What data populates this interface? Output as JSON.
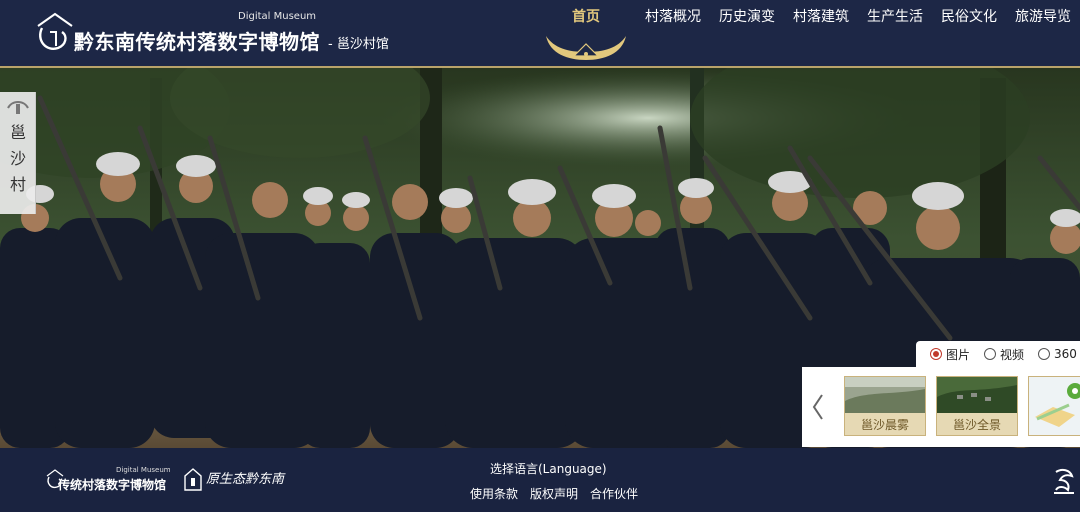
{
  "header": {
    "site_title": "黔东南传统村落数字博物馆",
    "digital_museum": "Digital Museum",
    "village": "- 邕沙村馆",
    "nav": [
      {
        "label": "首页",
        "active": true
      },
      {
        "label": "村落概况"
      },
      {
        "label": "历史演变"
      },
      {
        "label": "村落建筑"
      },
      {
        "label": "生产生活"
      },
      {
        "label": "民俗文化"
      },
      {
        "label": "旅游导览"
      }
    ]
  },
  "side_tab": {
    "label": "邕沙村"
  },
  "media_toggle": {
    "options": [
      {
        "label": "图片",
        "selected": true
      },
      {
        "label": "视频",
        "selected": false
      },
      {
        "label": "360",
        "selected": false
      }
    ]
  },
  "thumbnails": [
    {
      "label": "邕沙晨雾"
    },
    {
      "label": "邕沙全景"
    },
    {
      "label": ""
    }
  ],
  "footer": {
    "logo_title": "传统村落数字博物馆",
    "logo_dm": "Digital Museum",
    "partner_name": "原生态黔东南",
    "language_label": "选择语言(Language)",
    "links": [
      "使用条款",
      "版权声明",
      "合作伙伴"
    ]
  },
  "colors": {
    "header_bg": "#1d2746",
    "footer_bg": "#1a2340",
    "accent_gold": "#e2c87d",
    "radio_red": "#c0392b"
  },
  "icons": [
    "museum-logo-icon",
    "horn-ornament-icon",
    "chevron-left-icon",
    "map-pin-icon",
    "partner-logo-icon",
    "corner-logo-icon"
  ]
}
